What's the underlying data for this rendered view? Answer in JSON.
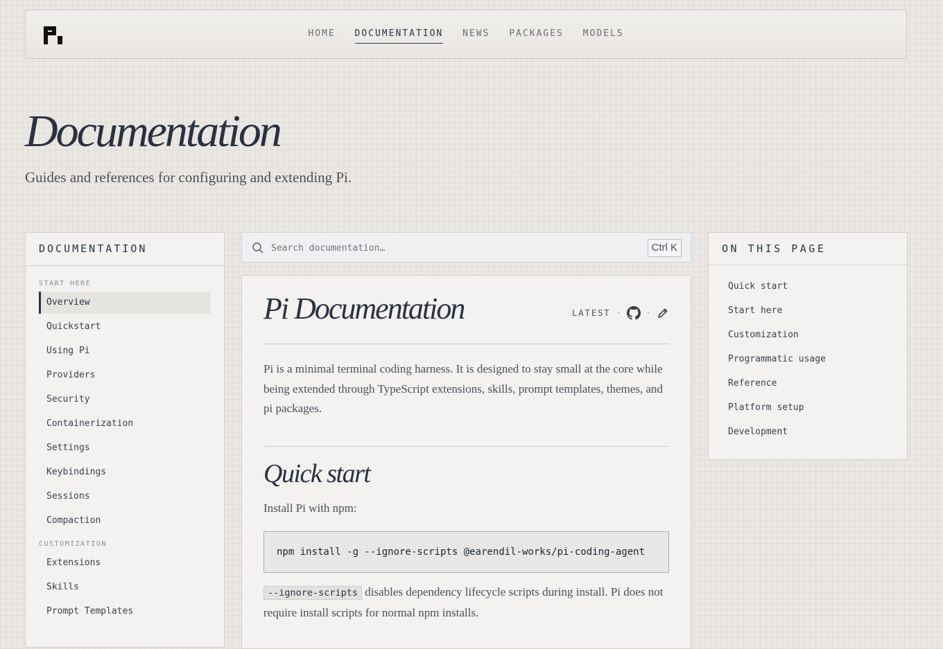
{
  "header": {
    "logo_icon": "pi-logo-icon",
    "nav": [
      {
        "label": "HOME",
        "active": false
      },
      {
        "label": "DOCUMENTATION",
        "active": true
      },
      {
        "label": "NEWS",
        "active": false
      },
      {
        "label": "PACKAGES",
        "active": false
      },
      {
        "label": "MODELS",
        "active": false
      }
    ]
  },
  "hero": {
    "title": "Documentation",
    "subtitle": "Guides and references for configuring and extending Pi."
  },
  "sidebar": {
    "title": "DOCUMENTATION",
    "sections": [
      {
        "label": "START HERE",
        "items": [
          "Overview",
          "Quickstart",
          "Using Pi",
          "Providers",
          "Security",
          "Containerization",
          "Settings",
          "Keybindings",
          "Sessions",
          "Compaction"
        ]
      },
      {
        "label": "CUSTOMIZATION",
        "items": [
          "Extensions",
          "Skills",
          "Prompt Templates"
        ]
      }
    ],
    "active_item": "Overview"
  },
  "search": {
    "placeholder": "Search documentation…",
    "shortcut": "Ctrl K",
    "icon": "search-icon"
  },
  "article": {
    "title": "Pi Documentation",
    "version_label": "LATEST",
    "meta_separator": "·",
    "github_icon": "github-icon",
    "edit_icon": "pencil-icon",
    "intro": "Pi is a minimal terminal coding harness. It is designed to stay small at the core while being extended through TypeScript extensions, skills, prompt templates, themes, and pi packages.",
    "quickstart_heading": "Quick start",
    "install_text": "Install Pi with npm:",
    "install_command": "npm install -g --ignore-scripts @earendil-works/pi-coding-agent",
    "note_code": "--ignore-scripts",
    "note_text": " disables dependency lifecycle scripts during install. Pi does not require install scripts for normal npm installs."
  },
  "toc": {
    "title": "ON THIS PAGE",
    "items": [
      "Quick start",
      "Start here",
      "Customization",
      "Programmatic usage",
      "Reference",
      "Platform setup",
      "Development"
    ]
  },
  "colors": {
    "ink": "#2c3340",
    "muted": "#4a4f58",
    "panel": "#f3f2f0",
    "background": "#ebe8e4",
    "search_bg": "#eef0f2"
  }
}
